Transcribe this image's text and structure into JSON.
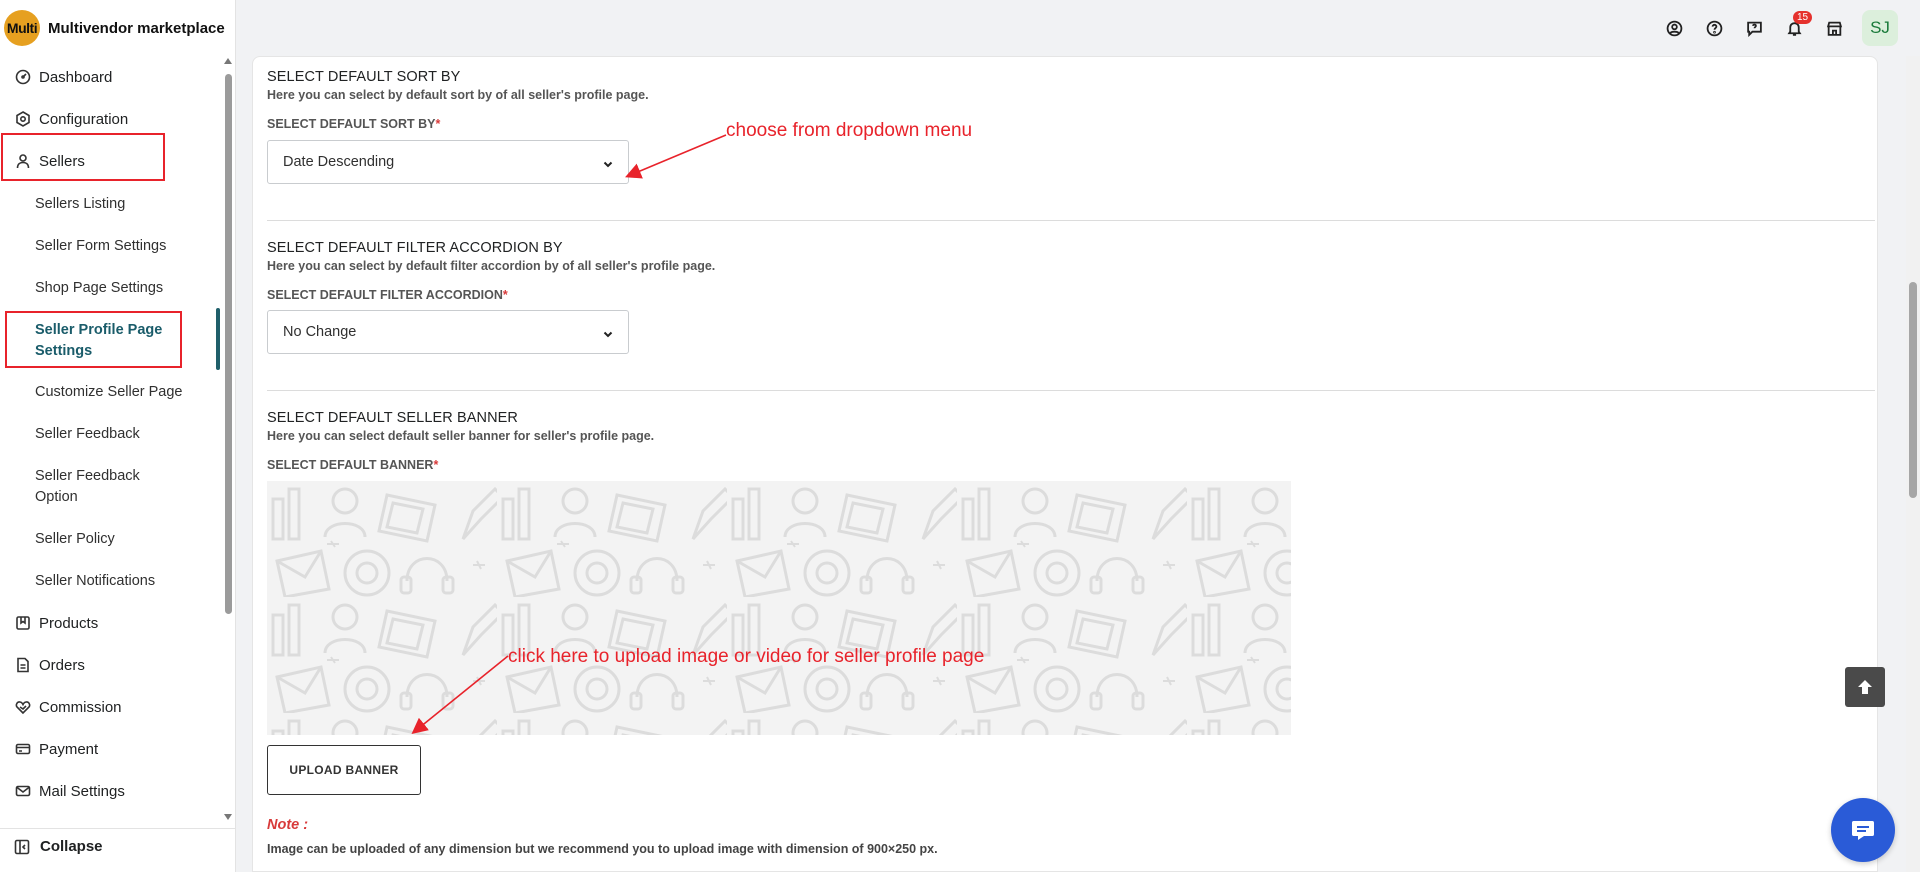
{
  "app": {
    "logo_text": "Multi",
    "name": "Multivendor marketplace"
  },
  "sidebar": {
    "items": [
      {
        "label": "Dashboard",
        "icon": "dashboard-icon"
      },
      {
        "label": "Configuration",
        "icon": "hexagon-gear-icon"
      },
      {
        "label": "Sellers",
        "icon": "user-icon"
      }
    ],
    "sellers_sub": [
      "Sellers Listing",
      "Seller Form Settings",
      "Shop Page Settings",
      "Seller Profile Page Settings",
      "Customize Seller Page",
      "Seller Feedback",
      "Seller Feedback Option",
      "Seller Policy",
      "Seller Notifications"
    ],
    "more_items": [
      {
        "label": "Products",
        "icon": "product-icon"
      },
      {
        "label": "Orders",
        "icon": "orders-icon"
      },
      {
        "label": "Commission",
        "icon": "commission-icon"
      },
      {
        "label": "Payment",
        "icon": "payment-icon"
      },
      {
        "label": "Mail Settings",
        "icon": "mail-icon"
      }
    ],
    "collapse_label": "Collapse"
  },
  "topbar": {
    "notification_count": "15",
    "avatar_initials": "SJ"
  },
  "sections": {
    "sort": {
      "title": "SELECT DEFAULT SORT BY",
      "desc": "Here you can select by default sort by of all seller's profile page.",
      "label": "SELECT DEFAULT SORT BY",
      "required": "*",
      "value": "Date Descending"
    },
    "filter": {
      "title": "SELECT DEFAULT FILTER ACCORDION BY",
      "desc": "Here you can select by default filter accordion by of all seller's profile page.",
      "label": "SELECT DEFAULT FILTER ACCORDION",
      "required": "*",
      "value": "No Change"
    },
    "banner": {
      "title": "SELECT DEFAULT SELLER BANNER",
      "desc": "Here you can select default seller banner for seller's profile page.",
      "label": "SELECT DEFAULT BANNER",
      "required": "*",
      "upload_label": "UPLOAD BANNER",
      "note_label": "Note :",
      "note_text": "Image can be uploaded of any dimension but we recommend you to upload image with dimension of 900×250 px."
    }
  },
  "annotations": {
    "dropdown": "choose from dropdown menu",
    "upload": "click here to upload image or video for seller profile page",
    "color": "#e8232b"
  }
}
